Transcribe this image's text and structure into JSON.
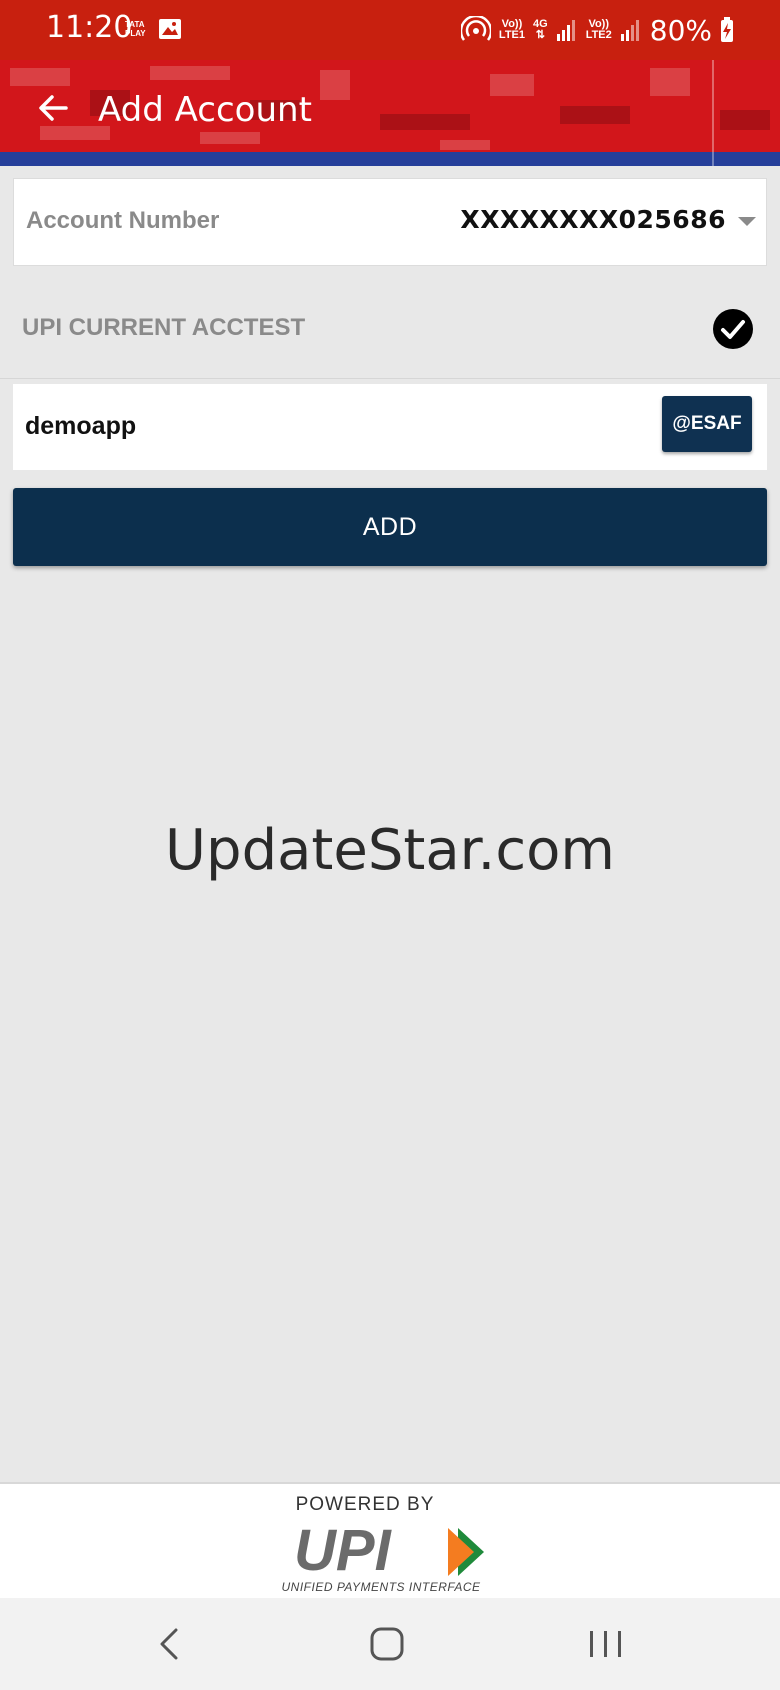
{
  "status_bar": {
    "time": "11:20",
    "carrier_badge_top": "TATA",
    "carrier_badge_bottom": "PLAY",
    "sim1_top": "Vo))",
    "sim1_bottom": "LTE1",
    "network_type": "4G",
    "sim2_top": "Vo))",
    "sim2_bottom": "LTE2",
    "battery_percent": "80%"
  },
  "app_bar": {
    "title": "Add Account",
    "back_icon": "arrow-left-icon",
    "color": "#d2161b",
    "accent_strip_color": "#263f9a"
  },
  "account_selector": {
    "label": "Account Number",
    "selected_value": "XXXXXXXX025686"
  },
  "account_name": {
    "text": "UPI CURRENT ACCTEST",
    "verified": true
  },
  "vpa": {
    "value": "demoapp",
    "suffix_label": "@ESAF"
  },
  "actions": {
    "add_label": "ADD",
    "button_color": "#0c2f4d"
  },
  "watermark": "UpdateStar.com",
  "footer": {
    "powered_by": "POWERED BY",
    "brand_text": "UPI",
    "brand_subtitle": "UNIFIED PAYMENTS INTERFACE"
  },
  "nav_bar": {
    "back_icon": "chevron-left-icon",
    "home_icon": "home-square-icon",
    "recents_icon": "recents-bars-icon"
  }
}
